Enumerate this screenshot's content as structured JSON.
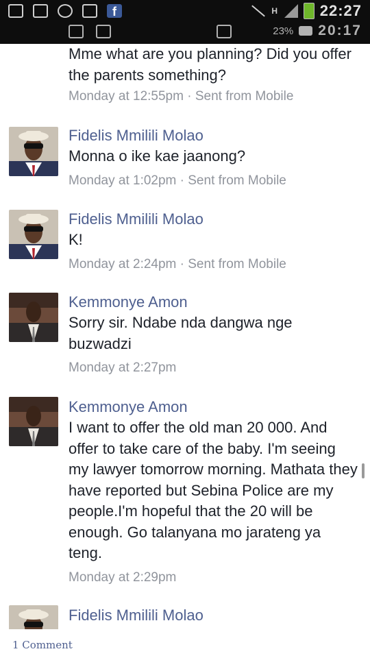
{
  "status_bar": {
    "time": "22:27",
    "reflected_battery": "23%",
    "reflected_time": "20:17",
    "network_label": "H",
    "notification_icons": [
      "facebook-lite-icon",
      "facebook-lite-icon",
      "whatsapp-icon",
      "gallery-icon",
      "facebook-icon"
    ],
    "facebook_glyph": "f",
    "battery_color": "#6fb72b"
  },
  "thread": {
    "partial_message": {
      "text": "Mme what are you planning? Did you offer the parents something?",
      "meta": "Monday at 12:55pm · Sent from Mobile"
    },
    "messages": [
      {
        "sender": "Fidelis Mmilili Molao",
        "text": "Monna o ike kae jaanong?",
        "meta": "Monday at 1:02pm · Sent from Mobile"
      },
      {
        "sender": "Fidelis Mmilili Molao",
        "text": "K!",
        "meta": "Monday at 2:24pm · Sent from Mobile"
      },
      {
        "sender": "Kemmonye Amon",
        "text": "Sorry sir. Ndabe nda dangwa nge buzwadzi",
        "meta": "Monday at 2:27pm"
      },
      {
        "sender": "Kemmonye Amon",
        "text": "I want to offer the old man 20 000. And offer to take care of the baby. I'm seeing my lawyer tomorrow morning. Mathata they have reported but Sebina Police are my people.I'm hopeful that the 20 will be enough. Go talanyana mo jarateng ya teng.",
        "meta": "Monday at 2:29pm"
      },
      {
        "sender": "Fidelis Mmilili Molao",
        "text": "",
        "meta": ""
      }
    ]
  },
  "footer": {
    "comments_link": "1 Comment"
  },
  "colors": {
    "sender_name": "#4e5f8f",
    "message_text": "#1d2129",
    "meta_text": "#90949c",
    "divider": "#e1e1e1"
  }
}
